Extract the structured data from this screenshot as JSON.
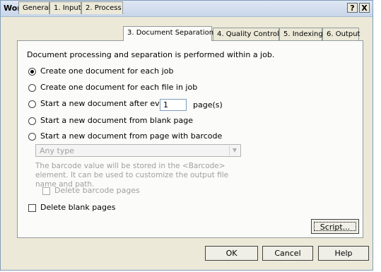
{
  "window": {
    "title": "Workflow Properties",
    "help_btn": "?",
    "close_btn": "X"
  },
  "tabs": [
    {
      "label": "General"
    },
    {
      "label": "1. Input"
    },
    {
      "label": "2. Process"
    },
    {
      "label": "3. Document Separation",
      "active": true
    },
    {
      "label": "4. Quality Control"
    },
    {
      "label": "5. Indexing"
    },
    {
      "label": "6. Output"
    }
  ],
  "panel": {
    "intro": "Document processing and separation is performed within a job.",
    "options": {
      "per_job": "Create one document for each job",
      "per_file": "Create one document for each file in job",
      "every_pages_prefix": "Start a new document after every",
      "every_pages_value": "1",
      "every_pages_suffix": "page(s)",
      "blank_page": "Start a new document from blank page",
      "barcode": "Start a new document from page with barcode"
    },
    "selected_option": "per_job",
    "barcode_type": "Any type",
    "barcode_note": "The barcode value will be stored in the <Barcode> element. It can be used to customize the output file name and path.",
    "delete_barcode_pages": "Delete barcode pages",
    "delete_blank_pages": "Delete blank pages",
    "script_btn": "Script..."
  },
  "footer": {
    "ok": "OK",
    "cancel": "Cancel",
    "help": "Help"
  }
}
